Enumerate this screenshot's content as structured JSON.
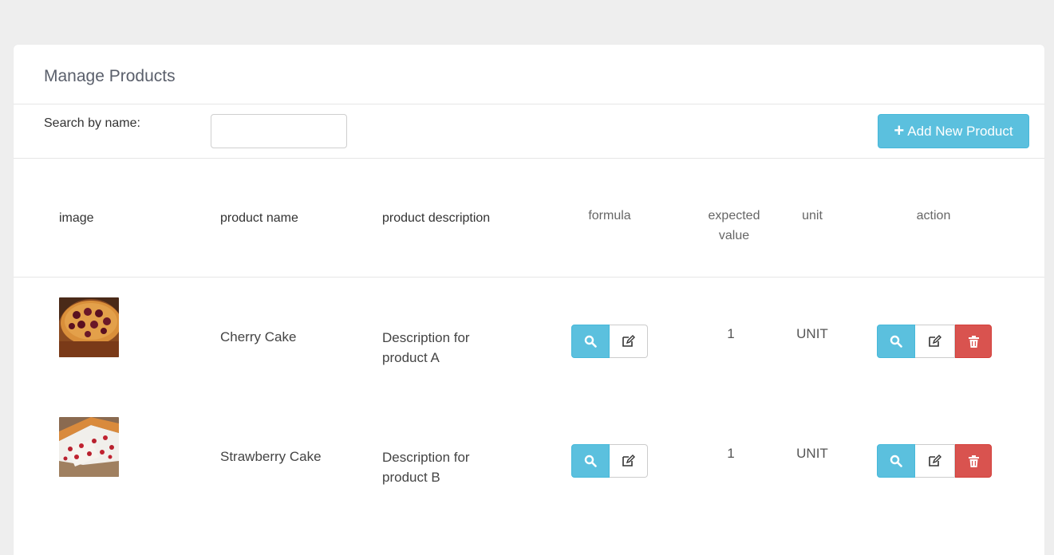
{
  "panel": {
    "title": "Manage Products"
  },
  "search": {
    "label": "Search by name:",
    "value": "",
    "placeholder": ""
  },
  "toolbar": {
    "add_label": "Add New Product"
  },
  "table": {
    "headers": {
      "image": "image",
      "name": "product name",
      "description": "product description",
      "formula": "formula",
      "expected_value_line1": "expected",
      "expected_value_line2": "value",
      "unit": "unit",
      "action": "action"
    },
    "rows": [
      {
        "image": "cherry-cake-photo",
        "name": "Cherry Cake",
        "description_line1": "Description for",
        "description_line2": "product A",
        "expected_value": "1",
        "unit": "UNIT"
      },
      {
        "image": "strawberry-cake-photo",
        "name": "Strawberry Cake",
        "description_line1": "Description for",
        "description_line2": "product B",
        "expected_value": "1",
        "unit": "UNIT"
      }
    ]
  },
  "icons": {
    "view": "search-icon",
    "edit": "edit-icon",
    "delete": "trash-icon",
    "add": "plus-icon"
  },
  "colors": {
    "info": "#5bc0de",
    "danger": "#d9534f",
    "background": "#eeeeee"
  }
}
